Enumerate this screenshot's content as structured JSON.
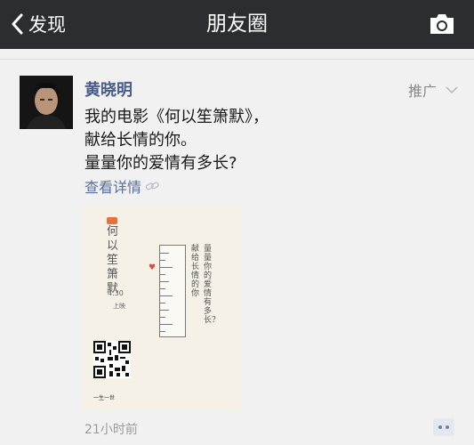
{
  "navbar": {
    "back_label": "发现",
    "title": "朋友圈"
  },
  "post": {
    "author": "黄晓明",
    "promo_label": "推广",
    "lines": [
      "我的电影《何以笙箫默》，",
      "献给长情的你。",
      "量量你的爱情有多长?"
    ],
    "detail_link": "查看详情",
    "timestamp": "21小时前"
  },
  "poster": {
    "tag": "一生",
    "title": "何以笙箫默",
    "date": "4.30",
    "sub": "上映",
    "line_one": "量量你的爱情有多长?",
    "line_two": "献给长情的你",
    "brand": "一生一世"
  },
  "colors": {
    "navbar_bg": "#2b2d31",
    "author_link": "#4a5d8a",
    "link": "#5a6e99",
    "page_bg": "#f1f1f1"
  },
  "icons": {
    "back": "chevron-left-icon",
    "camera": "camera-icon",
    "link": "link-icon",
    "promo_dropdown": "chevron-down-icon",
    "comment": "comment-icon"
  }
}
